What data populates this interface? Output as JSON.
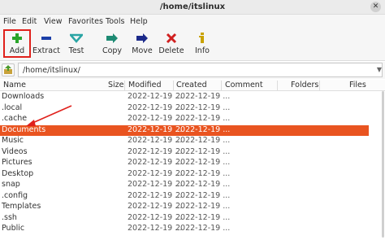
{
  "window": {
    "title": "/home/itslinux"
  },
  "menu": [
    "File",
    "Edit",
    "View",
    "Favorites",
    "Tools",
    "Help"
  ],
  "toolbar": {
    "buttons": [
      {
        "label": "Add",
        "icon": "plus-icon",
        "color": "#2aa52a"
      },
      {
        "label": "Extract",
        "icon": "minus-icon",
        "color": "#1c3fa8"
      },
      {
        "label": "Test",
        "icon": "check-icon",
        "color": "#2aa5a5"
      },
      {
        "label": "Copy",
        "icon": "double-arrow-icon",
        "color": "#1d8a73"
      },
      {
        "label": "Move",
        "icon": "arrow-right-icon",
        "color": "#1c2a8a"
      },
      {
        "label": "Delete",
        "icon": "x-icon",
        "color": "#d02020"
      },
      {
        "label": "Info",
        "icon": "info-icon",
        "color": "#c9a200"
      }
    ]
  },
  "address": {
    "value": "/home/itslinux/"
  },
  "columns": [
    "Name",
    "Size",
    "Modified",
    "Created",
    "Comment",
    "Folders",
    "Files"
  ],
  "rows": [
    {
      "name": "Downloads",
      "modified": "2022-12-19 ...",
      "created": "2022-12-19 ..."
    },
    {
      "name": ".local",
      "modified": "2022-12-19 ...",
      "created": "2022-12-19 ..."
    },
    {
      "name": ".cache",
      "modified": "2022-12-19 ...",
      "created": "2022-12-19 ..."
    },
    {
      "name": "Documents",
      "modified": "2022-12-19 ...",
      "created": "2022-12-19 ...",
      "selected": true
    },
    {
      "name": "Music",
      "modified": "2022-12-19 ...",
      "created": "2022-12-19 ..."
    },
    {
      "name": "Videos",
      "modified": "2022-12-19 ...",
      "created": "2022-12-19 ..."
    },
    {
      "name": "Pictures",
      "modified": "2022-12-19 ...",
      "created": "2022-12-19 ..."
    },
    {
      "name": "Desktop",
      "modified": "2022-12-19 ...",
      "created": "2022-12-19 ..."
    },
    {
      "name": "snap",
      "modified": "2022-12-19 ...",
      "created": "2022-12-19 ..."
    },
    {
      "name": ".config",
      "modified": "2022-12-19 ...",
      "created": "2022-12-19 ..."
    },
    {
      "name": "Templates",
      "modified": "2022-12-19 ...",
      "created": "2022-12-19 ..."
    },
    {
      "name": ".ssh",
      "modified": "2022-12-19 ...",
      "created": "2022-12-19 ..."
    },
    {
      "name": "Public",
      "modified": "2022-12-19 ...",
      "created": "2022-12-19 ..."
    }
  ],
  "colors": {
    "selection": "#e95420",
    "highlight_box": "#e0211c",
    "annotation_arrow": "#e0211c"
  }
}
